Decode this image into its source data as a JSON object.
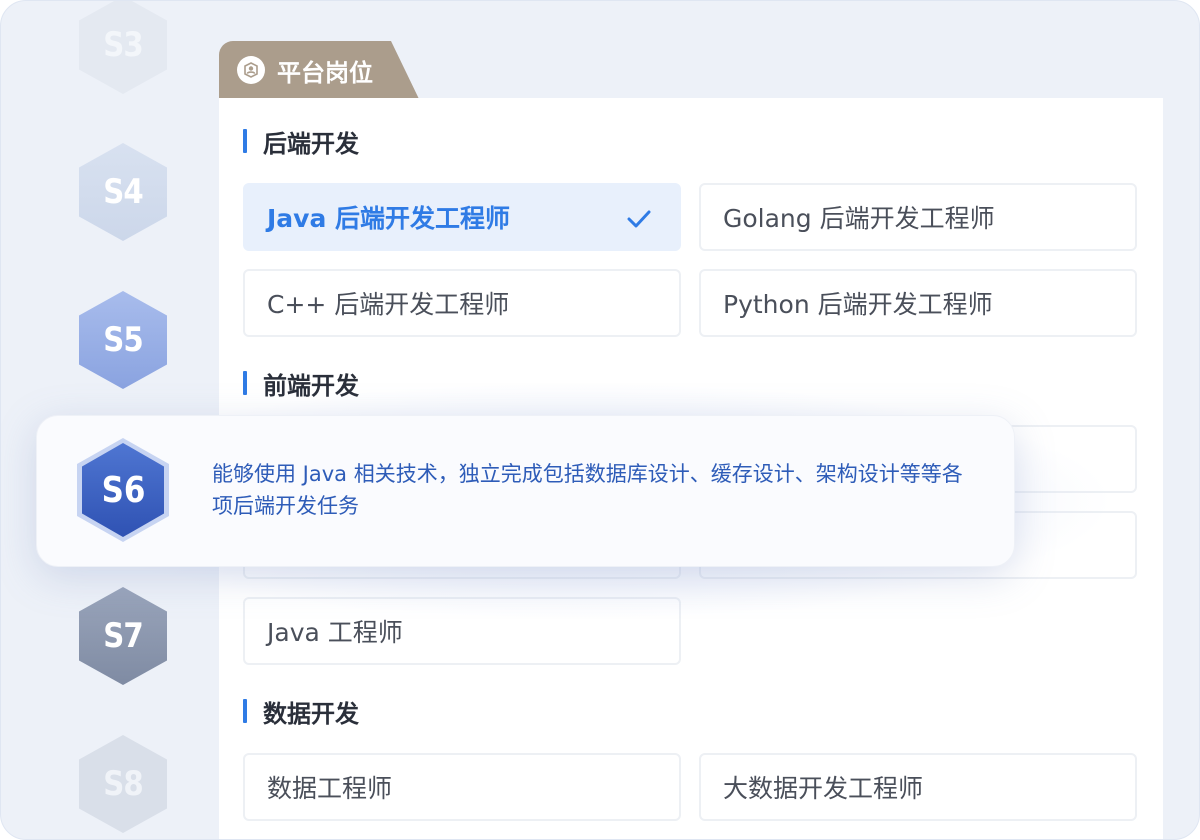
{
  "levels": {
    "s3": "S3",
    "s4": "S4",
    "s5": "S5",
    "s6": "S6",
    "s7": "S7",
    "s8": "S8"
  },
  "tab": {
    "label": "平台岗位",
    "icon": "person-icon"
  },
  "sections": {
    "backend": {
      "title": "后端开发",
      "options": [
        "Java 后端开发工程师",
        "Golang 后端开发工程师",
        "C++ 后端开发工程师",
        "Python 后端开发工程师"
      ],
      "selected": "Java 后端开发工程师"
    },
    "frontend": {
      "title": "前端开发",
      "options": [
        "Java 工程师"
      ]
    },
    "data": {
      "title": "数据开发",
      "options": [
        "数据工程师",
        "大数据开发工程师"
      ]
    }
  },
  "tooltip": {
    "level": "S6",
    "text": "能够使用 Java 相关技术，独立完成包括数据库设计、缓存设计、架构设计等等各项后端开发任务"
  },
  "colors": {
    "accent": "#2f7be5",
    "tab": "#ab9d8c",
    "tooltip_text": "#2e5cb8"
  }
}
